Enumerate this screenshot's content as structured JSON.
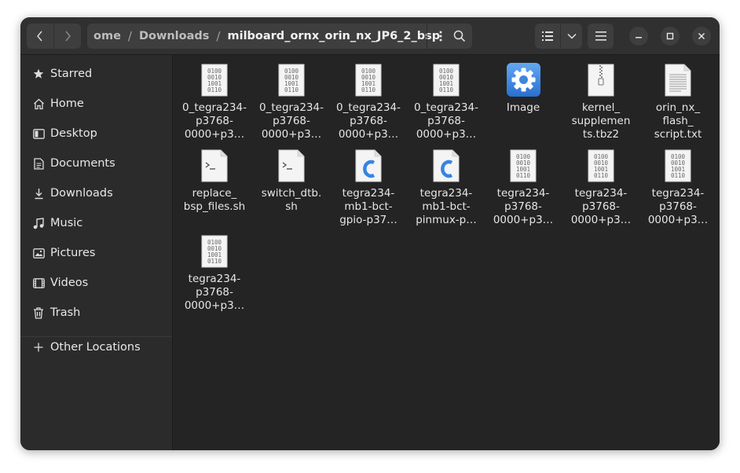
{
  "window": {
    "title": "milboard_ornx_orin_nx_JP6_2_bsp"
  },
  "pathbar": {
    "crumbs": [
      "ome",
      "Downloads",
      "milboard_ornx_orin_nx_JP6_2_bsp"
    ],
    "separator": "/"
  },
  "sidebar": {
    "items": [
      {
        "label": "Starred",
        "icon": "star-icon"
      },
      {
        "label": "Home",
        "icon": "home-icon"
      },
      {
        "label": "Desktop",
        "icon": "desktop-icon"
      },
      {
        "label": "Documents",
        "icon": "documents-icon"
      },
      {
        "label": "Downloads",
        "icon": "downloads-icon"
      },
      {
        "label": "Music",
        "icon": "music-icon"
      },
      {
        "label": "Pictures",
        "icon": "pictures-icon"
      },
      {
        "label": "Videos",
        "icon": "videos-icon"
      },
      {
        "label": "Trash",
        "icon": "trash-icon"
      }
    ],
    "other": {
      "label": "Other Locations",
      "icon": "plus-icon"
    }
  },
  "files": [
    {
      "name": "0_tegra234-\np3768-\n0000+p3…",
      "type": "binary"
    },
    {
      "name": "0_tegra234-\np3768-\n0000+p3…",
      "type": "binary"
    },
    {
      "name": "0_tegra234-\np3768-\n0000+p3…",
      "type": "binary"
    },
    {
      "name": "0_tegra234-\np3768-\n0000+p3…",
      "type": "binary"
    },
    {
      "name": "Image",
      "type": "executable"
    },
    {
      "name": "kernel_\nsupplemen\nts.tbz2",
      "type": "archive"
    },
    {
      "name": "orin_nx_\nflash_\nscript.txt",
      "type": "text"
    },
    {
      "name": "replace_\nbsp_files.sh",
      "type": "script"
    },
    {
      "name": "switch_dtb.\nsh",
      "type": "script"
    },
    {
      "name": "tegra234-\nmb1-bct-\ngpio-p37…",
      "type": "c-source"
    },
    {
      "name": "tegra234-\nmb1-bct-\npinmux-p…",
      "type": "c-source"
    },
    {
      "name": "tegra234-\np3768-\n0000+p3…",
      "type": "binary"
    },
    {
      "name": "tegra234-\np3768-\n0000+p3…",
      "type": "binary"
    },
    {
      "name": "tegra234-\np3768-\n0000+p3…",
      "type": "binary"
    },
    {
      "name": "tegra234-\np3768-\n0000+p3…",
      "type": "binary"
    }
  ],
  "binary_glyph": [
    "0100",
    "0010",
    "1001",
    "0110"
  ],
  "colors": {
    "window_bg": "#242424",
    "header_bg": "#303030",
    "sidebar_bg": "#2b2b2b",
    "accent_blue": "#3584e4"
  }
}
